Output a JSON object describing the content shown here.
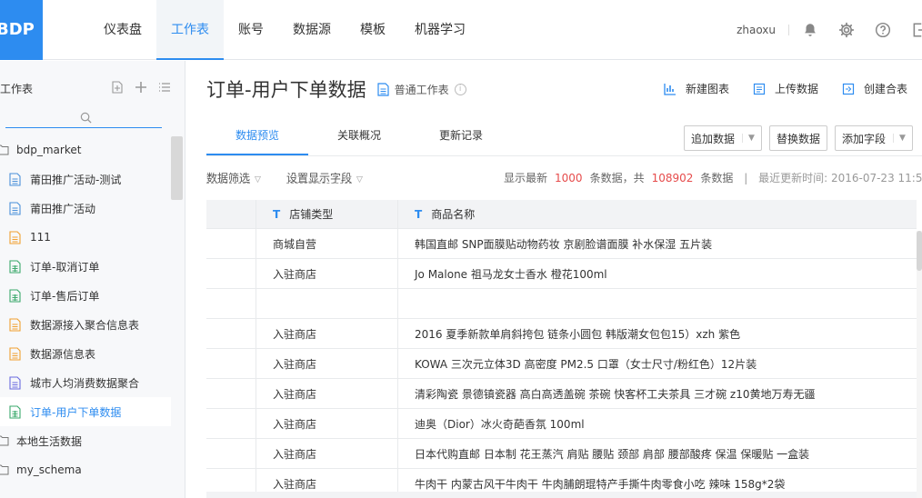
{
  "logo": {
    "text": "BDP"
  },
  "nav": {
    "items": [
      "仪表盘",
      "工作表",
      "账号",
      "数据源",
      "模板",
      "机器学习"
    ],
    "active_index": 1
  },
  "user": {
    "name": "zhaoxu"
  },
  "icons": {
    "bell": "bell-icon",
    "settings": "gear-icon",
    "help": "help-circle-icon",
    "logout": "logout-icon"
  },
  "sidebar": {
    "title": "工作表",
    "items": [
      {
        "type": "folder",
        "label": "bdp_market"
      },
      {
        "type": "sheet",
        "label": "莆田推广活动-测试",
        "icon": "blue"
      },
      {
        "type": "sheet",
        "label": "莆田推广活动",
        "icon": "blue"
      },
      {
        "type": "sheet",
        "label": "111",
        "icon": "orange"
      },
      {
        "type": "sheet",
        "label": "订单-取消订单",
        "icon": "green"
      },
      {
        "type": "sheet",
        "label": "订单-售后订单",
        "icon": "green"
      },
      {
        "type": "sheet",
        "label": "数据源接入聚合信息表",
        "icon": "orange"
      },
      {
        "type": "sheet",
        "label": "数据源信息表",
        "icon": "orange"
      },
      {
        "type": "sheet",
        "label": "城市人均消费数据聚合",
        "icon": "purple"
      },
      {
        "type": "sheet",
        "label": "订单-用户下单数据",
        "icon": "green",
        "active": true
      },
      {
        "type": "folder",
        "label": "本地生活数据"
      },
      {
        "type": "folder",
        "label": "my_schema"
      }
    ]
  },
  "page": {
    "title": "订单-用户下单数据",
    "sheet_type": "普通工作表",
    "actions": [
      "新建图表",
      "上传数据",
      "创建合表"
    ]
  },
  "tabs": [
    "数据预览",
    "关联概况",
    "更新记录"
  ],
  "buttons": {
    "append": "追加数据",
    "replace": "替换数据",
    "add_field": "添加字段"
  },
  "filters": {
    "filter_label": "数据筛选",
    "display_fields_label": "设置显示字段"
  },
  "stats": {
    "prefix": "显示最新",
    "shown": "1000",
    "middle": "条数据，共",
    "total": "108902",
    "suffix": "条数据",
    "updated_label": "最近更新时间: 2016-07-23 11:52:2"
  },
  "table": {
    "columns": [
      "店铺类型",
      "商品名称"
    ],
    "rows": [
      [
        "商城自营",
        "韩国直邮 SNP面膜贴动物药妆 京剧脸谱面膜 补水保湿 五片装"
      ],
      [
        "入驻商店",
        "Jo Malone 祖马龙女士香水 橙花100ml"
      ],
      [
        "",
        ""
      ],
      [
        "入驻商店",
        "2016 夏季新款单肩斜挎包 链条小圆包 韩版潮女包包15）xzh 紫色"
      ],
      [
        "入驻商店",
        "KOWA 三次元立体3D 高密度 PM2.5 口罩（女士尺寸/粉红色）12片装"
      ],
      [
        "入驻商店",
        "清彩陶瓷 景德镇瓷器 高白高透盖碗 茶碗 快客杯工夫茶具 三才碗 z10黄地万寿无疆"
      ],
      [
        "入驻商店",
        "迪奥（Dior）冰火奇葩香氛 100ml"
      ],
      [
        "入驻商店",
        "日本代购直邮 日本制 花王蒸汽 肩贴 腰贴 颈部 肩部 腰部酸疼 保温 保暖贴 一盒装"
      ],
      [
        "入驻商店",
        "牛肉干 内蒙古风干牛肉干 牛肉脯朗琨特产手撕牛肉零食小吃 辣味 158g*2袋"
      ]
    ]
  },
  "colors": {
    "accent": "#2d8cf0",
    "highlight": "#e64b4b"
  }
}
